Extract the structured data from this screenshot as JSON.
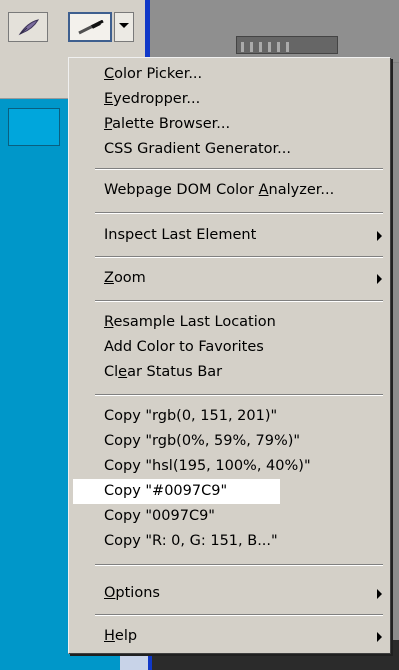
{
  "toolbar": {
    "left_icon": "feather-icon",
    "active_icon": "eyedropper-icon",
    "dropdown_icon": "chevron-down-icon"
  },
  "colors": {
    "accent": "#0097C9",
    "menu_bg": "#d4d0c8",
    "highlight": "#ffffff"
  },
  "menu": {
    "group1": [
      {
        "pre": "",
        "ul": "C",
        "post": "olor Picker..."
      },
      {
        "pre": "",
        "ul": "E",
        "post": "yedropper..."
      },
      {
        "pre": "",
        "ul": "P",
        "post": "alette Browser..."
      },
      {
        "pre": "CSS Gradient Generator...",
        "ul": "",
        "post": ""
      }
    ],
    "group2": [
      {
        "pre": "Webpage DOM Color ",
        "ul": "A",
        "post": "nalyzer..."
      }
    ],
    "group3": [
      {
        "pre": "Inspect Last Element",
        "ul": "",
        "post": ""
      }
    ],
    "group4": [
      {
        "pre": "",
        "ul": "Z",
        "post": "oom"
      }
    ],
    "group5": [
      {
        "pre": "",
        "ul": "R",
        "post": "esample Last Location"
      },
      {
        "pre": "Add Color to Favorites",
        "ul": "",
        "post": ""
      },
      {
        "pre": "Cl",
        "ul": "e",
        "post": "ar Status Bar"
      }
    ],
    "group6": [
      {
        "pre": "Copy \"rgb(0, 151, 201)\"",
        "ul": "",
        "post": ""
      },
      {
        "pre": "Copy \"rgb(0%, 59%, 79%)\"",
        "ul": "",
        "post": ""
      },
      {
        "pre": "Copy \"hsl(195, 100%, 40%)\"",
        "ul": "",
        "post": ""
      },
      {
        "pre": "Copy \"#0097C9\"",
        "ul": "",
        "post": ""
      },
      {
        "pre": "Copy \"0097C9\"",
        "ul": "",
        "post": ""
      },
      {
        "pre": "Copy \"R: 0, G: 151, B...\"",
        "ul": "",
        "post": ""
      }
    ],
    "group7": [
      {
        "pre": "",
        "ul": "O",
        "post": "ptions"
      }
    ],
    "group8": [
      {
        "pre": "",
        "ul": "H",
        "post": "elp"
      }
    ]
  }
}
